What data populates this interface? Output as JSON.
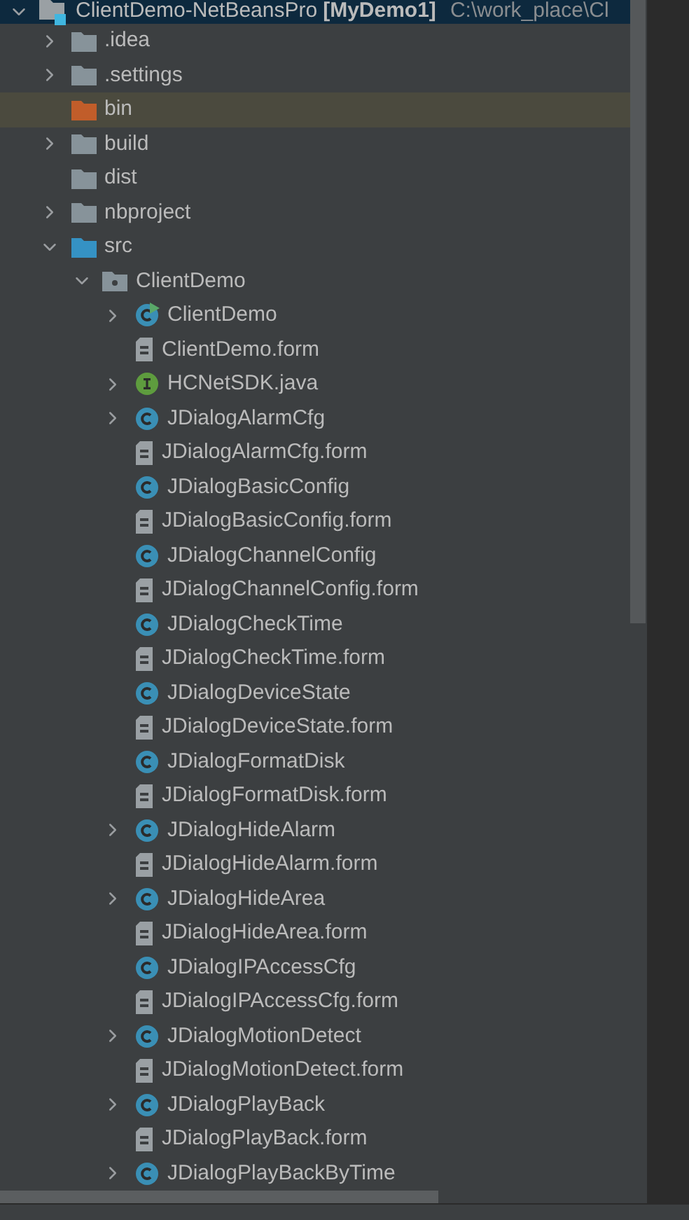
{
  "tree": {
    "kind": "module",
    "label": "ClientDemo-NetBeansPro",
    "module": "[MyDemo1]",
    "path": "C:\\work_place\\Cl",
    "expanded": true,
    "selected": false,
    "children": [
      {
        "kind": "folder",
        "label": ".idea",
        "expanded": false,
        "selected": false
      },
      {
        "kind": "folder",
        "label": ".settings",
        "expanded": false,
        "selected": false
      },
      {
        "kind": "excluded",
        "label": "bin",
        "selected": true
      },
      {
        "kind": "folder",
        "label": "build",
        "expanded": false,
        "selected": false
      },
      {
        "kind": "folder",
        "label": "dist",
        "selected": false
      },
      {
        "kind": "folder",
        "label": "nbproject",
        "expanded": false,
        "selected": false
      },
      {
        "kind": "source",
        "label": "src",
        "expanded": true,
        "selected": false,
        "children": [
          {
            "kind": "package",
            "label": "ClientDemo",
            "expanded": true,
            "selected": false,
            "children": [
              {
                "kind": "main",
                "label": "ClientDemo",
                "expanded": false,
                "selected": false
              },
              {
                "kind": "form",
                "label": "ClientDemo.form",
                "selected": false
              },
              {
                "kind": "interface",
                "label": "HCNetSDK.java",
                "expanded": false,
                "selected": false
              },
              {
                "kind": "class",
                "label": "JDialogAlarmCfg",
                "expanded": false,
                "selected": false
              },
              {
                "kind": "form",
                "label": "JDialogAlarmCfg.form",
                "selected": false
              },
              {
                "kind": "class",
                "label": "JDialogBasicConfig",
                "selected": false
              },
              {
                "kind": "form",
                "label": "JDialogBasicConfig.form",
                "selected": false
              },
              {
                "kind": "class",
                "label": "JDialogChannelConfig",
                "selected": false
              },
              {
                "kind": "form",
                "label": "JDialogChannelConfig.form",
                "selected": false
              },
              {
                "kind": "class",
                "label": "JDialogCheckTime",
                "selected": false
              },
              {
                "kind": "form",
                "label": "JDialogCheckTime.form",
                "selected": false
              },
              {
                "kind": "class",
                "label": "JDialogDeviceState",
                "selected": false
              },
              {
                "kind": "form",
                "label": "JDialogDeviceState.form",
                "selected": false
              },
              {
                "kind": "class",
                "label": "JDialogFormatDisk",
                "selected": false
              },
              {
                "kind": "form",
                "label": "JDialogFormatDisk.form",
                "selected": false
              },
              {
                "kind": "class",
                "label": "JDialogHideAlarm",
                "expanded": false,
                "selected": false
              },
              {
                "kind": "form",
                "label": "JDialogHideAlarm.form",
                "selected": false
              },
              {
                "kind": "class",
                "label": "JDialogHideArea",
                "expanded": false,
                "selected": false
              },
              {
                "kind": "form",
                "label": "JDialogHideArea.form",
                "selected": false
              },
              {
                "kind": "class",
                "label": "JDialogIPAccessCfg",
                "selected": false
              },
              {
                "kind": "form",
                "label": "JDialogIPAccessCfg.form",
                "selected": false
              },
              {
                "kind": "class",
                "label": "JDialogMotionDetect",
                "expanded": false,
                "selected": false
              },
              {
                "kind": "form",
                "label": "JDialogMotionDetect.form",
                "selected": false
              },
              {
                "kind": "class",
                "label": "JDialogPlayBack",
                "expanded": false,
                "selected": false
              },
              {
                "kind": "form",
                "label": "JDialogPlayBack.form",
                "selected": false
              },
              {
                "kind": "class",
                "label": "JDialogPlayBackByTime",
                "expanded": false,
                "selected": false
              }
            ]
          }
        ]
      }
    ]
  }
}
